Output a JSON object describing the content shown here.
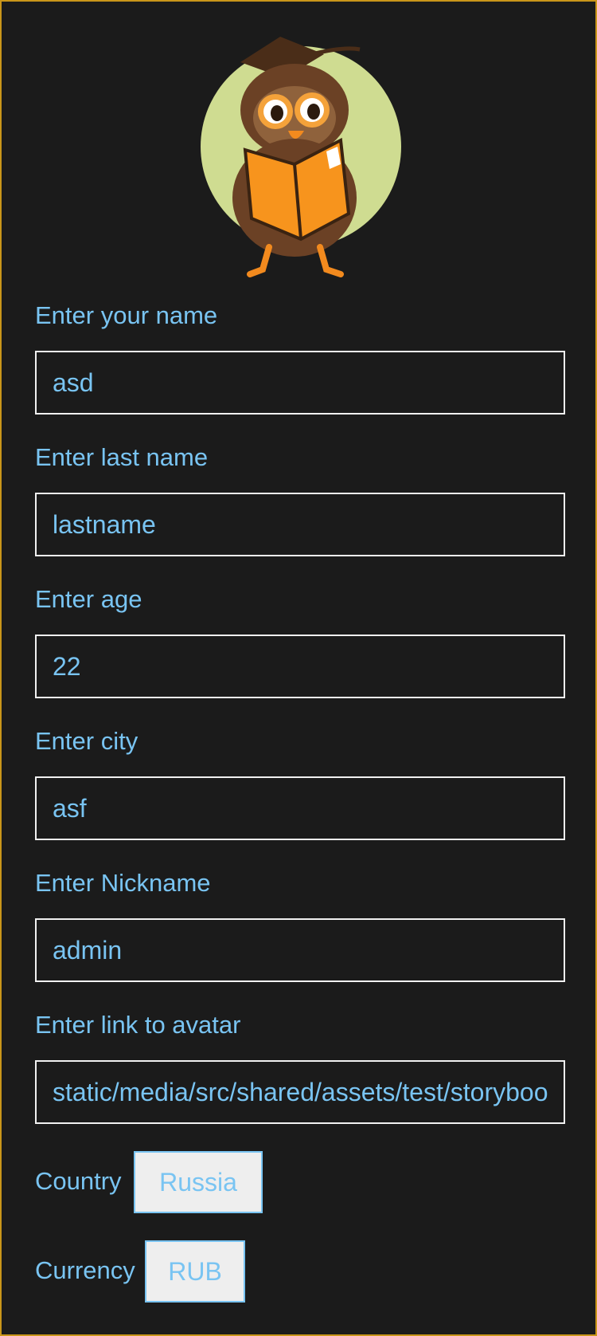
{
  "avatar": {
    "icon": "owl-reading-book-icon"
  },
  "form": {
    "name": {
      "label": "Enter your name",
      "value": "asd"
    },
    "last_name": {
      "label": "Enter last name",
      "value": "lastname"
    },
    "age": {
      "label": "Enter age",
      "value": "22"
    },
    "city": {
      "label": "Enter city",
      "value": "asf"
    },
    "nickname": {
      "label": "Enter Nickname",
      "value": "admin"
    },
    "avatar_link": {
      "label": "Enter link to avatar",
      "value": "static/media/src/shared/assets/test/storybook.jpg"
    },
    "country": {
      "label": "Country",
      "value": "Russia"
    },
    "currency": {
      "label": "Currency",
      "value": "RUB"
    }
  },
  "colors": {
    "background": "#1b1b1b",
    "accent": "#79c4f2",
    "frame_border": "#c9961a",
    "field_border": "#f1f1f1",
    "select_bg": "#eeeeee"
  }
}
